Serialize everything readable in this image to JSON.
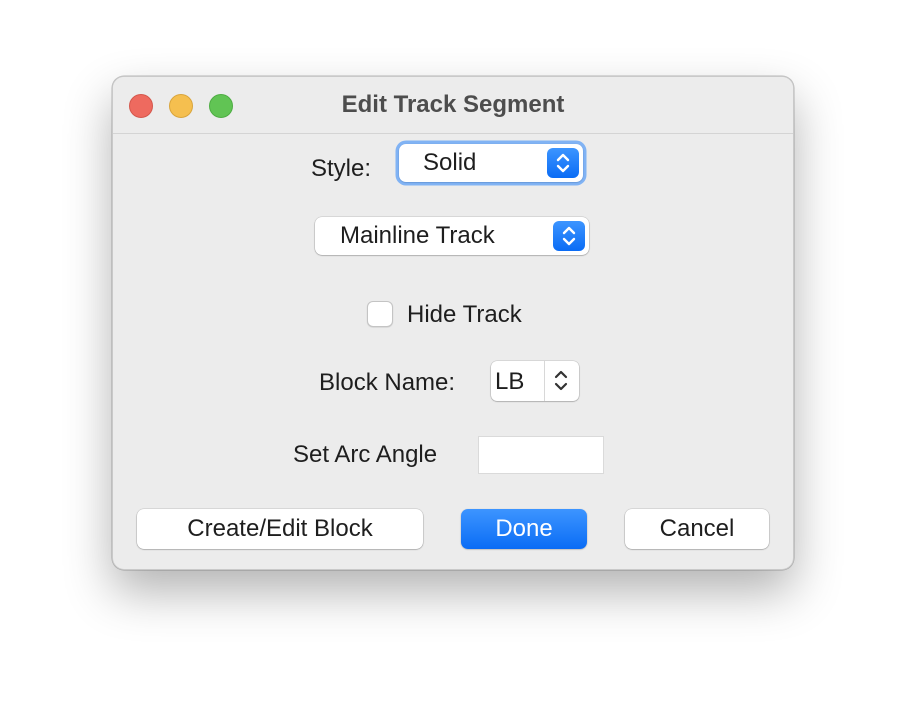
{
  "window": {
    "title": "Edit Track Segment"
  },
  "style": {
    "label": "Style:",
    "selected": "Solid"
  },
  "track_type": {
    "selected": "Mainline Track"
  },
  "hide_track": {
    "label": "Hide Track",
    "checked": false
  },
  "block_name": {
    "label": "Block Name:",
    "value": "LB"
  },
  "arc_angle": {
    "label": "Set Arc Angle",
    "value": ""
  },
  "buttons": {
    "create_edit_block": "Create/Edit Block",
    "done": "Done",
    "cancel": "Cancel"
  },
  "colors": {
    "accent": "#0a6cf5",
    "close": "#ee6a5f",
    "minimize": "#f5bf4f",
    "zoom": "#61c454"
  },
  "icons": {
    "popup_arrows": "chevron-up-down-icon",
    "spinner_arrows": "chevron-up-down-icon"
  }
}
